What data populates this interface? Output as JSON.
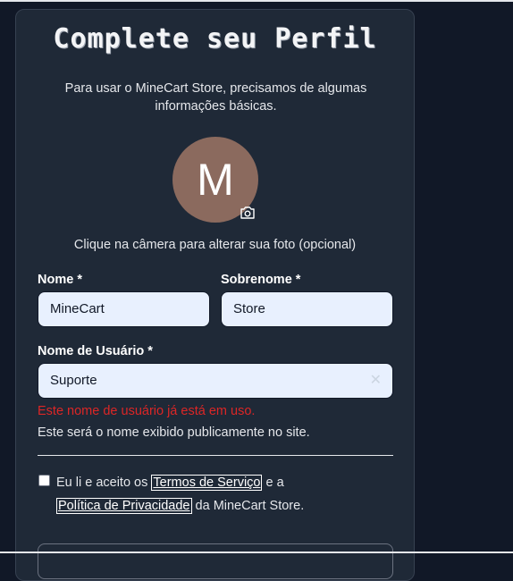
{
  "form": {
    "title": "Complete seu Perfil",
    "subtitle": "Para usar o MineCart Store, precisamos de algumas informações básicas.",
    "avatar_initial": "M",
    "camera_hint": "Clique na câmera para alterar sua foto (opcional)",
    "first_name": {
      "label": "Nome *",
      "value": "MineCart"
    },
    "last_name": {
      "label": "Sobrenome *",
      "value": "Store"
    },
    "username": {
      "label": "Nome de Usuário *",
      "value": "Suporte",
      "error": "Este nome de usuário já está em uso.",
      "help": "Este será o nome exibido publicamente no site."
    },
    "terms": {
      "prefix": "Eu li e aceito os",
      "terms_link": "Termos de Serviço",
      "middle": "e a",
      "privacy_link": "Política de Privacidade",
      "suffix": "da MineCart Store.",
      "checked": false
    }
  },
  "colors": {
    "page_bg": "#111827",
    "card_bg": "#1f2937",
    "input_bg": "#e8f0fe",
    "avatar_bg": "#8b6a5e",
    "error": "#dc2626"
  }
}
